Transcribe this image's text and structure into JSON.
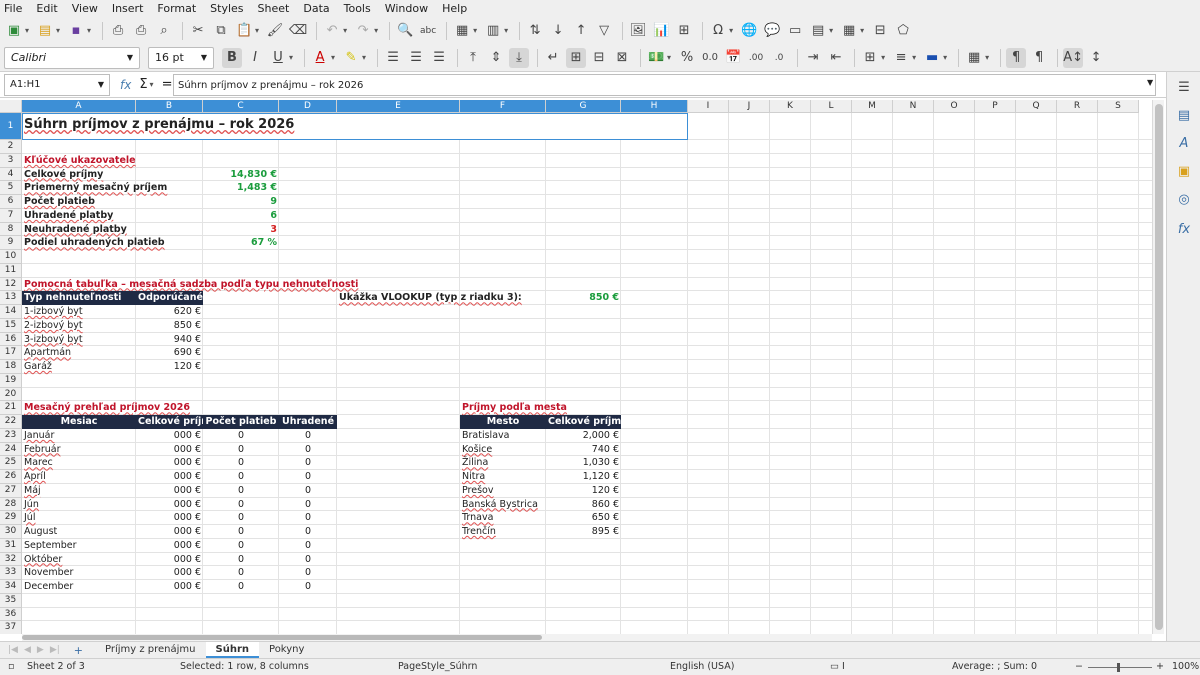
{
  "menu": [
    "File",
    "Edit",
    "View",
    "Insert",
    "Format",
    "Styles",
    "Sheet",
    "Data",
    "Tools",
    "Window",
    "Help"
  ],
  "toolbar": {
    "font_name": "Calibri",
    "font_size": "16 pt"
  },
  "formula_bar": {
    "name_box": "A1:H1",
    "formula": "Súhrn príjmov z prenájmu – rok 2026"
  },
  "columns": [
    "A",
    "B",
    "C",
    "D",
    "E",
    "F",
    "G",
    "H",
    "I",
    "J",
    "K",
    "L",
    "M",
    "N",
    "O",
    "P",
    "Q",
    "R",
    "S"
  ],
  "sheet": {
    "title": "Súhrn príjmov z prenájmu – rok 2026",
    "kpi_title": "Kľúčové ukazovatele",
    "kpis": [
      {
        "label": "Celkové príjmy",
        "value": "14,830 €",
        "color": "green"
      },
      {
        "label": "Priemerný mesačný príjem",
        "value": "1,483 €",
        "color": "green"
      },
      {
        "label": "Počet platieb",
        "value": "9",
        "color": "green"
      },
      {
        "label": "Uhradené platby",
        "value": "6",
        "color": "green"
      },
      {
        "label": "Neuhradené platby",
        "value": "3",
        "color": "red"
      },
      {
        "label": "Podiel uhradených platieb",
        "value": "67 %",
        "color": "green"
      }
    ],
    "lookup_title": "Pomocná tabuľka – mesačná sadzba podľa typu nehnuteľnosti",
    "lookup_headers": [
      "Typ nehnuteľnosti",
      "Odporúčané ná"
    ],
    "lookup_rows": [
      {
        "type": "1-izbový byt",
        "rate": "620 €"
      },
      {
        "type": "2-izbový byt",
        "rate": "850 €"
      },
      {
        "type": "3-izbový byt",
        "rate": "940 €"
      },
      {
        "type": "Apartmán",
        "rate": "690 €"
      },
      {
        "type": "Garáž",
        "rate": "120 €"
      }
    ],
    "vlookup_label": "Ukážka VLOOKUP (typ z riadku 3):",
    "vlookup_value": "850 €",
    "monthly_title": "Mesačný prehľad príjmov 2026",
    "monthly_headers": [
      "Mesiac",
      "Celkové príjmy",
      "Počet platieb",
      "Uhradené"
    ],
    "monthly_rows": [
      {
        "month": "Január",
        "income": "000 €",
        "count": "0",
        "paid": "0"
      },
      {
        "month": "Február",
        "income": "000 €",
        "count": "0",
        "paid": "0"
      },
      {
        "month": "Marec",
        "income": "000 €",
        "count": "0",
        "paid": "0"
      },
      {
        "month": "Apríl",
        "income": "000 €",
        "count": "0",
        "paid": "0"
      },
      {
        "month": "Máj",
        "income": "000 €",
        "count": "0",
        "paid": "0"
      },
      {
        "month": "Jún",
        "income": "000 €",
        "count": "0",
        "paid": "0"
      },
      {
        "month": "Júl",
        "income": "000 €",
        "count": "0",
        "paid": "0"
      },
      {
        "month": "August",
        "income": "000 €",
        "count": "0",
        "paid": "0"
      },
      {
        "month": "September",
        "income": "000 €",
        "count": "0",
        "paid": "0"
      },
      {
        "month": "Október",
        "income": "000 €",
        "count": "0",
        "paid": "0"
      },
      {
        "month": "November",
        "income": "000 €",
        "count": "0",
        "paid": "0"
      },
      {
        "month": "December",
        "income": "000 €",
        "count": "0",
        "paid": "0"
      }
    ],
    "city_title": "Príjmy podľa mesta",
    "city_headers": [
      "Mesto",
      "Celkové príjmy"
    ],
    "city_rows": [
      {
        "city": "Bratislava",
        "income": "2,000 €"
      },
      {
        "city": "Košice",
        "income": "740 €"
      },
      {
        "city": "Žilina",
        "income": "1,030 €"
      },
      {
        "city": "Nitra",
        "income": "1,120 €"
      },
      {
        "city": "Prešov",
        "income": "120 €"
      },
      {
        "city": "Banská Bystrica",
        "income": "860 €"
      },
      {
        "city": "Trnava",
        "income": "650 €"
      },
      {
        "city": "Trenčín",
        "income": "895 €"
      }
    ]
  },
  "tabs": [
    "Príjmy z prenájmu",
    "Súhrn",
    "Pokyny"
  ],
  "status": {
    "sheet": "Sheet 2 of 3",
    "selection": "Selected: 1 row, 8 columns",
    "page_style": "PageStyle_Súhrn",
    "language": "English (USA)",
    "sum": "Average: ; Sum: 0",
    "zoom": "100%"
  }
}
